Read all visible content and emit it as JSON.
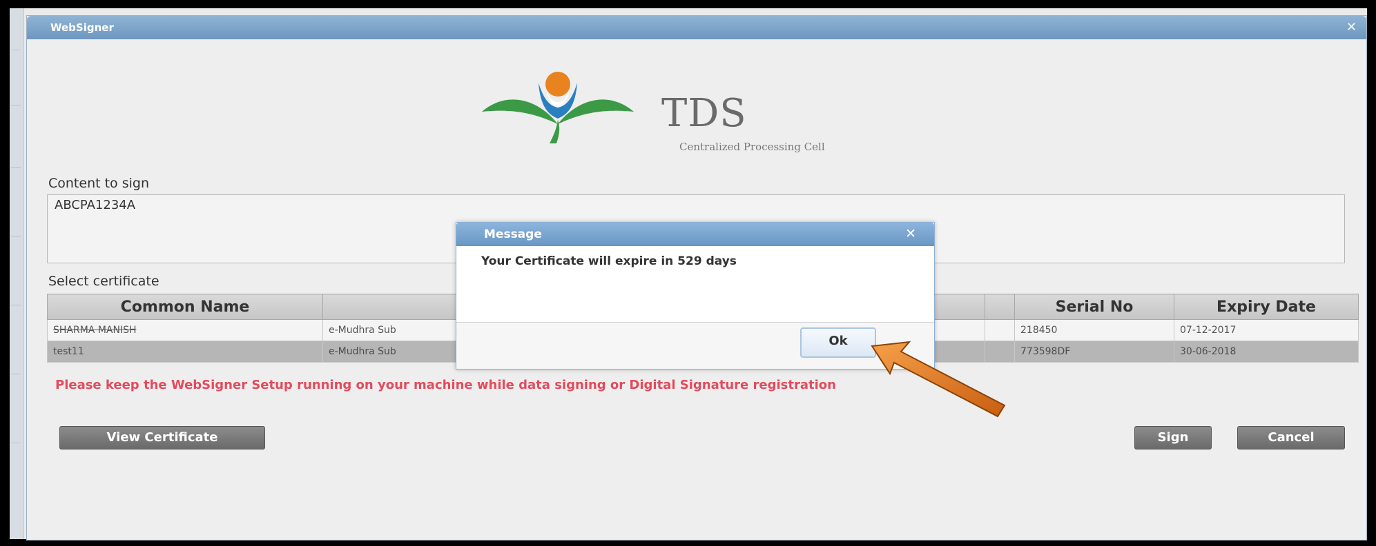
{
  "window": {
    "title": "WebSigner",
    "close_glyph": "✕"
  },
  "logo": {
    "brand": "TDS",
    "subtitle": "Centralized Processing Cell"
  },
  "content_to_sign": {
    "label": "Content to sign",
    "value": "ABCPA1234A"
  },
  "select_certificate": {
    "label": "Select certificate",
    "columns": [
      "Common Name",
      "",
      "",
      "Serial No",
      "Expiry Date"
    ],
    "rows": [
      {
        "common_name": "SHARMA MANISH",
        "issuer": "e-Mudhra Sub",
        "serial_no": "218450",
        "expiry_date": "07-12-2017"
      },
      {
        "common_name": "test11",
        "issuer": "e-Mudhra Sub",
        "serial_no": "773598DF",
        "expiry_date": "30-06-2018"
      }
    ]
  },
  "warning": "Please keep the WebSigner Setup running on your machine while data signing or Digital Signature registration",
  "buttons": {
    "view_certificate": "View Certificate",
    "sign": "Sign",
    "cancel": "Cancel"
  },
  "message_dialog": {
    "title": "Message",
    "close_glyph": "✕",
    "text": "Your Certificate will expire in 529 days",
    "ok_label": "Ok"
  },
  "colors": {
    "titlebar": "#7ea5cb",
    "warning_text": "#e44a5c",
    "button_gray": "#7a7a7a",
    "arrow_orange": "#e87a1e",
    "logo_orange": "#e8831f",
    "logo_blue": "#2a7fc1",
    "logo_green": "#3c9a46"
  }
}
